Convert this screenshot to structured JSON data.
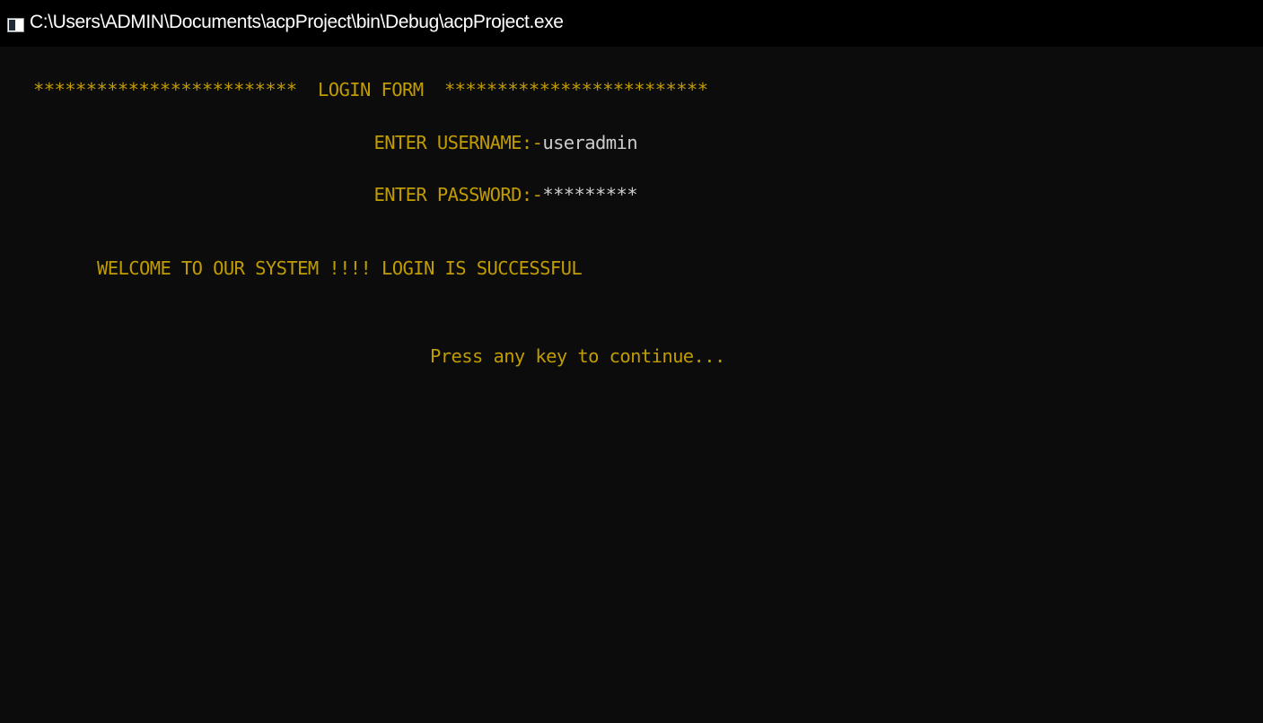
{
  "window": {
    "title": "C:\\Users\\ADMIN\\Documents\\acpProject\\bin\\Debug\\acpProject.exe",
    "icon": "console-app-icon"
  },
  "console": {
    "header": "*************************  LOGIN FORM  *************************",
    "username_prompt": "ENTER USERNAME:-",
    "username_value": "useradmin",
    "password_prompt": "ENTER PASSWORD:-",
    "password_value": "*********",
    "welcome_message": "WELCOME TO OUR SYSTEM !!!! LOGIN IS SUCCESSFUL",
    "continue_prompt": "Press any key to continue..."
  },
  "colors": {
    "background": "#0c0c0c",
    "titlebar": "#000000",
    "text_yellow": "#c19c00",
    "text_white": "#cccccc"
  }
}
